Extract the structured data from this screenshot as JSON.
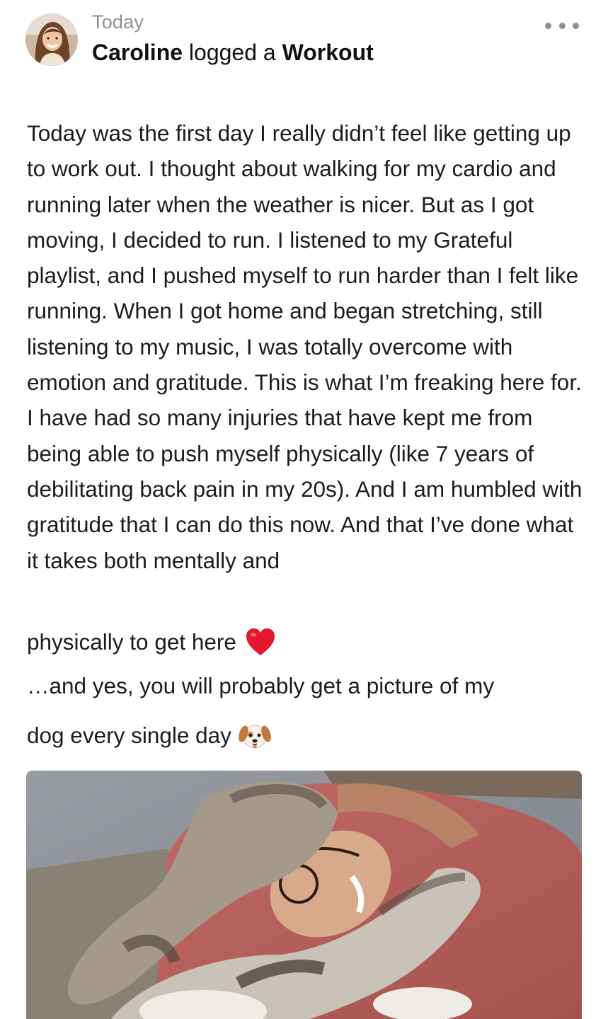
{
  "post": {
    "timestamp": "Today",
    "author": "Caroline",
    "action": " logged a ",
    "activity": "Workout",
    "more_menu_icon": "ellipsis-icon",
    "body_paragraph": "Today was the first day I really didn’t feel like getting up to work out. I thought about walking for my cardio and running later when the weather is nicer. But as I got moving, I decided to run. I listened to my Grateful playlist, and I pushed myself to run harder than I felt like running. When I got home and began stretching, still listening to my music, I was totally overcome with emotion and gratitude. This is what I’m freaking here for. I have had so many injuries that have kept me from being able to push myself physically (like 7 years of debilitating back pain in my 20s). And I am humbled with gratitude that I can do this now. And that I’ve done what it takes both mentally and",
    "line_physically": "physically to get here",
    "line_heart_icon": "red-heart-emoji",
    "line_yes": "…and yes, you will probably get a picture of my",
    "line_dog": "dog every single day",
    "line_dog_icon": "dog-face-emoji",
    "photo_icon": "photo-woman-with-dog"
  },
  "colors": {
    "text": "#1c1c1e",
    "muted": "#8e8e93",
    "heart": "#e3182d"
  }
}
